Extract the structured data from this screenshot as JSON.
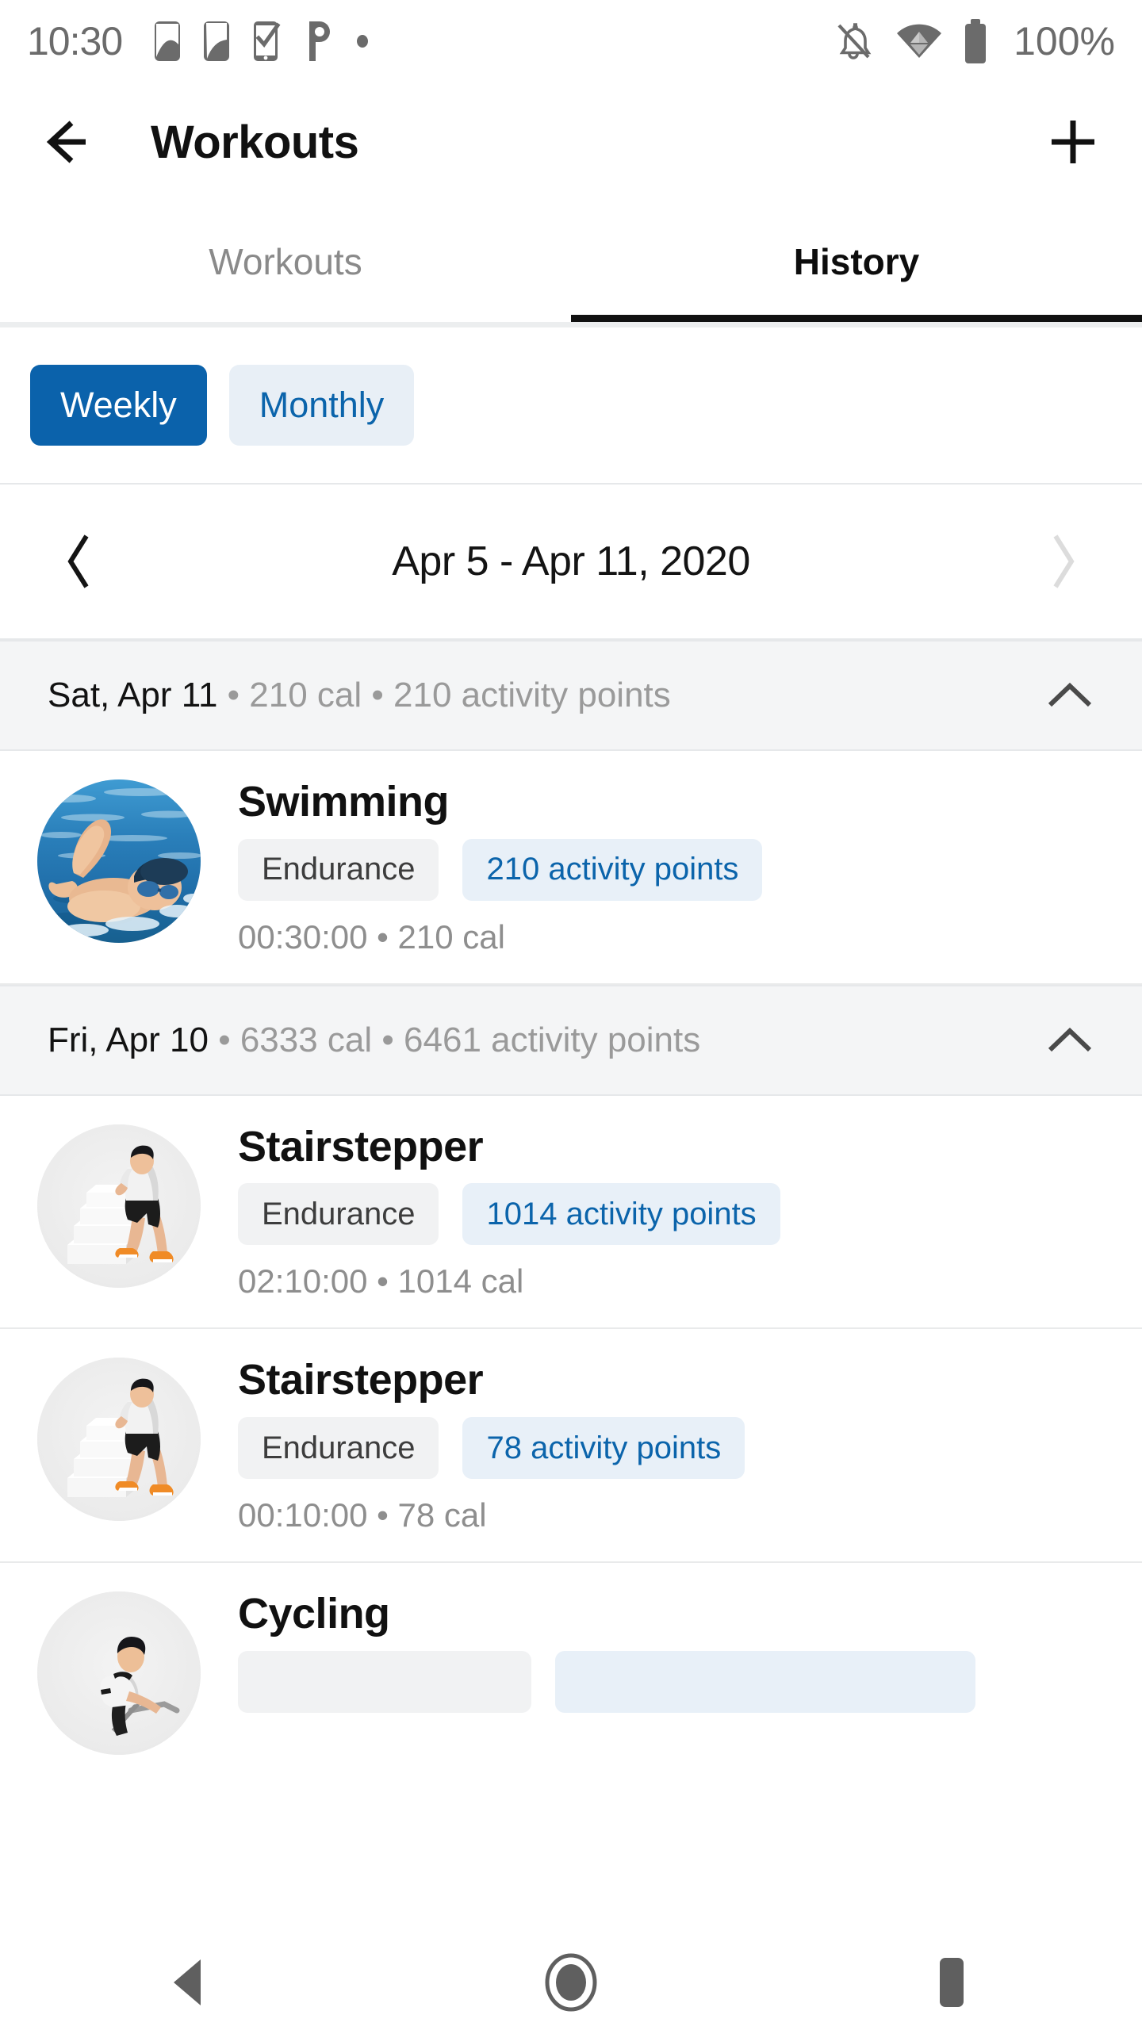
{
  "status_bar": {
    "time": "10:30",
    "battery_percent": "100%",
    "left_icons": [
      "sim-card-icon",
      "sim-card-icon",
      "phone-check-icon",
      "parking-p-icon",
      "dot-icon"
    ],
    "right_icons": [
      "notifications-off-icon",
      "wifi-icon",
      "battery-full-icon"
    ]
  },
  "app_bar": {
    "back_icon": "arrow-left-icon",
    "title": "Workouts",
    "add_icon": "plus-icon"
  },
  "tabs": [
    {
      "label": "Workouts",
      "active": false
    },
    {
      "label": "History",
      "active": true
    }
  ],
  "period_toggle": {
    "options": [
      {
        "label": "Weekly",
        "selected": true
      },
      {
        "label": "Monthly",
        "selected": false
      }
    ],
    "selected_bg": "#0b62ab",
    "unselected_bg": "#e8eff6",
    "unselected_text": "#0b64ab"
  },
  "date_nav": {
    "prev_icon": "chevron-left-icon",
    "range_label": "Apr 5 - Apr 11, 2020",
    "next_icon": "chevron-right-icon",
    "next_disabled": true
  },
  "days": [
    {
      "date_label": "Sat, Apr 11",
      "meta": " • 210 cal • 210 activity points",
      "collapse_icon": "chevron-up-icon",
      "expanded": true,
      "workouts": [
        {
          "name": "Swimming",
          "thumbnail": "swimming-photo",
          "category": "Endurance",
          "points": "210 activity points",
          "detail": "00:30:00 • 210 cal"
        }
      ]
    },
    {
      "date_label": "Fri, Apr 10",
      "meta": " • 6333 cal • 6461 activity points",
      "collapse_icon": "chevron-up-icon",
      "expanded": true,
      "workouts": [
        {
          "name": "Stairstepper",
          "thumbnail": "stairstepper-figure",
          "category": "Endurance",
          "points": "1014 activity points",
          "detail": "02:10:00 • 1014 cal"
        },
        {
          "name": "Stairstepper",
          "thumbnail": "stairstepper-figure",
          "category": "Endurance",
          "points": "78 activity points",
          "detail": "00:10:00 • 78 cal"
        },
        {
          "name": "Cycling",
          "thumbnail": "cycling-figure",
          "category": "",
          "points": "",
          "detail": ""
        }
      ]
    }
  ],
  "nav_bar": {
    "back_icon": "nav-back-triangle-icon",
    "home_icon": "nav-home-circle-icon",
    "recents_icon": "nav-recents-square-icon"
  },
  "colors": {
    "accent": "#0b62ab",
    "chip_points_bg": "#e8f0f8",
    "chip_points_text": "#0b64ab",
    "chip_cat_bg": "#f1f2f3",
    "day_header_bg": "#f4f5f6",
    "muted_text": "#9a9a9a"
  }
}
